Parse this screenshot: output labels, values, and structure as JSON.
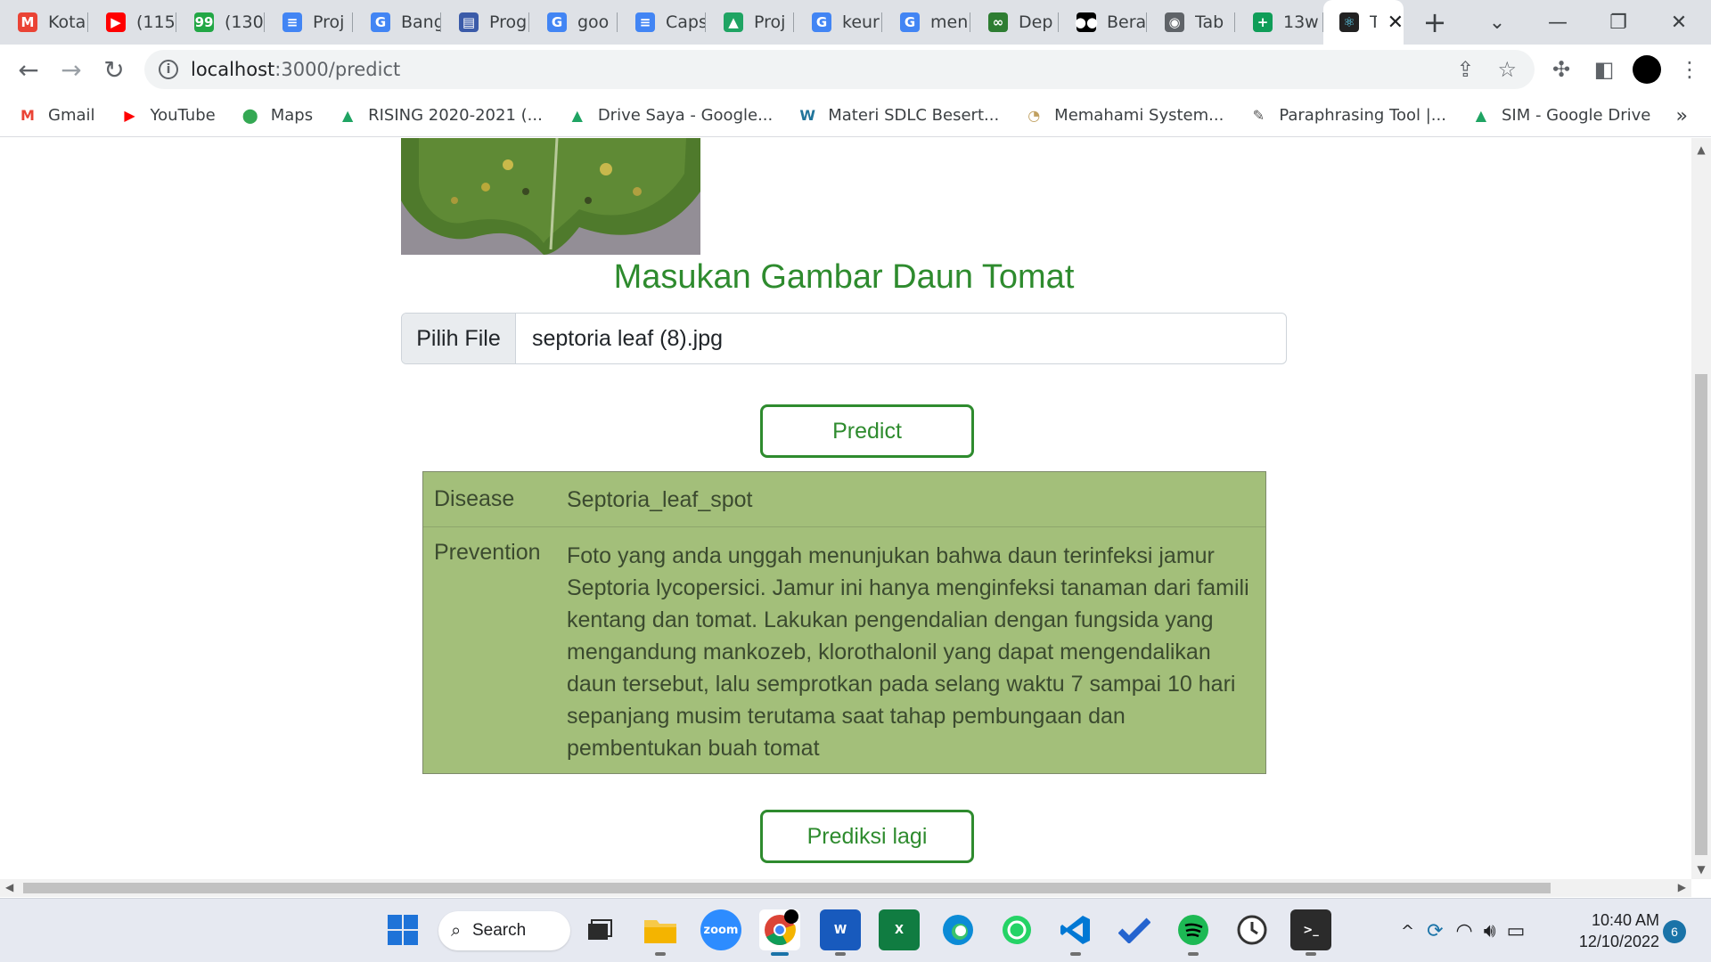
{
  "browser": {
    "tabs": [
      {
        "title": "Kota",
        "icon": "gmail-icon",
        "color": "#ea4335",
        "glyph": "M"
      },
      {
        "title": "(115",
        "icon": "youtube-icon",
        "color": "#ff0000",
        "glyph": "▶"
      },
      {
        "title": "(130",
        "icon": "chat-99-icon",
        "color": "#22a745",
        "glyph": "99"
      },
      {
        "title": "Proj",
        "icon": "google-docs-icon",
        "color": "#4285f4",
        "glyph": "≡"
      },
      {
        "title": "Bang",
        "icon": "google-icon",
        "color": "#4285f4",
        "glyph": "G"
      },
      {
        "title": "Prog",
        "icon": "site-icon",
        "color": "#3b5ba9",
        "glyph": "▤"
      },
      {
        "title": "goo",
        "icon": "google-icon",
        "color": "#4285f4",
        "glyph": "G"
      },
      {
        "title": "Caps",
        "icon": "google-docs-icon",
        "color": "#4285f4",
        "glyph": "≡"
      },
      {
        "title": "Proj",
        "icon": "google-drive-icon",
        "color": "#1fa463",
        "glyph": "▲"
      },
      {
        "title": "keur",
        "icon": "google-icon",
        "color": "#4285f4",
        "glyph": "G"
      },
      {
        "title": "men",
        "icon": "google-icon",
        "color": "#4285f4",
        "glyph": "G"
      },
      {
        "title": "Dep",
        "icon": "infinity-icon",
        "color": "#2e7d32",
        "glyph": "∞"
      },
      {
        "title": "Bera",
        "icon": "medium-icon",
        "color": "#000000",
        "glyph": "●●"
      },
      {
        "title": "Tab",
        "icon": "chrome-icon",
        "color": "#5f6368",
        "glyph": "◉"
      },
      {
        "title": "13w",
        "icon": "google-sheets-icon",
        "color": "#0f9d58",
        "glyph": "+"
      }
    ],
    "active_tab": {
      "title": "T",
      "icon": "react-icon",
      "color": "#222222",
      "glyph": "⚛"
    },
    "url_host": "localhost",
    "url_path": ":3000/predict",
    "bookmarks": [
      {
        "label": "Gmail",
        "icon": "gmail-icon",
        "color": "#ea4335",
        "glyph": "M"
      },
      {
        "label": "YouTube",
        "icon": "youtube-icon",
        "color": "#ff0000",
        "glyph": "▶"
      },
      {
        "label": "Maps",
        "icon": "maps-pin-icon",
        "color": "#34a853",
        "glyph": "⬤"
      },
      {
        "label": "RISING 2020-2021 (...",
        "icon": "google-drive-icon",
        "color": "#1fa463",
        "glyph": "▲"
      },
      {
        "label": "Drive Saya - Google...",
        "icon": "google-drive-icon",
        "color": "#1fa463",
        "glyph": "▲"
      },
      {
        "label": "Materi SDLC Besert...",
        "icon": "wordpress-icon",
        "color": "#21759b",
        "glyph": "W"
      },
      {
        "label": "Memahami System...",
        "icon": "site-icon",
        "color": "#c0a060",
        "glyph": "◔"
      },
      {
        "label": "Paraphrasing Tool |...",
        "icon": "quill-icon",
        "color": "#555555",
        "glyph": "✎"
      },
      {
        "label": "SIM - Google Drive",
        "icon": "google-drive-icon",
        "color": "#1fa463",
        "glyph": "▲"
      }
    ]
  },
  "page": {
    "heading": "Masukan Gambar Daun Tomat",
    "file_button": "Pilih File",
    "file_name": "septoria leaf (8).jpg",
    "predict_button": "Predict",
    "result": {
      "disease_label": "Disease",
      "disease_value": "Septoria_leaf_spot",
      "prevention_label": "Prevention",
      "prevention_value": "Foto yang anda unggah menunjukan bahwa daun terinfeksi jamur Septoria lycopersici. Jamur ini hanya menginfeksi tanaman dari famili kentang dan tomat. Lakukan pengendalian dengan fungsida yang mengandung mankozeb, klorothalonil yang dapat mengendalikan daun tersebut, lalu semprotkan pada selang waktu 7 sampai 10 hari sepanjang musim terutama saat tahap pembungaan dan pembentukan buah tomat"
    },
    "again_button": "Prediksi lagi",
    "accent_color": "#2e8b2e",
    "result_bg": "#a3bf7a"
  },
  "taskbar": {
    "search_label": "Search",
    "time": "10:40 AM",
    "date": "12/10/2022",
    "notifications": "6"
  }
}
